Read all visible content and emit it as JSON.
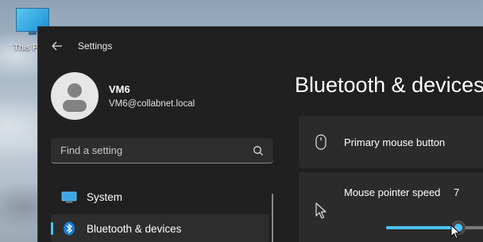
{
  "desktop": {
    "icon_label": "This PC"
  },
  "window": {
    "app_title": "Settings",
    "icons": {
      "back": "back-arrow-icon"
    }
  },
  "profile": {
    "name": "VM6",
    "email": "VM6@collabnet.local"
  },
  "search": {
    "placeholder": "Find a setting",
    "value": "",
    "icon": "search-icon"
  },
  "nav": {
    "items": [
      {
        "label": "System",
        "icon": "system-monitor-icon",
        "selected": false
      },
      {
        "label": "Bluetooth & devices",
        "icon": "bluetooth-icon",
        "selected": true
      }
    ]
  },
  "main": {
    "page_title": "Bluetooth & devices",
    "cards": [
      {
        "label": "Primary mouse button",
        "icon": "mouse-icon"
      },
      {
        "label": "Mouse pointer speed",
        "icon": "mouse-pointer-icon",
        "value": "7",
        "slider_fraction": 0.7
      }
    ]
  },
  "colors": {
    "accent": "#4cc2ff",
    "window_bg": "#202020",
    "card_bg": "#2b2b2b"
  }
}
